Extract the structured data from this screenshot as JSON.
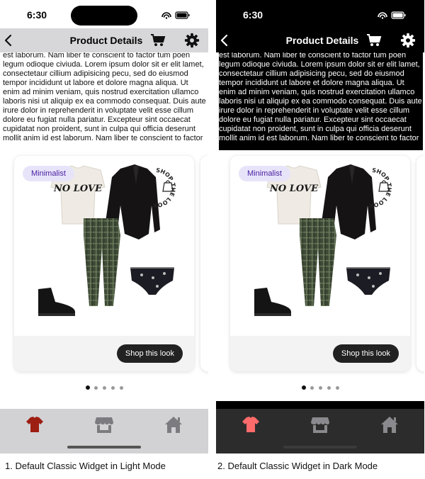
{
  "colors": {
    "accent": "#9d1e12",
    "dark_accent": "#ff6b6b",
    "badge_bg": "#e7e4fa",
    "badge_text": "#4a1da0",
    "dot_active": "#111111",
    "dot_inactive": "#999999"
  },
  "status": {
    "time": "6:30"
  },
  "nav": {
    "title": "Product Details",
    "icons": [
      "chevron-left-icon",
      "cart-icon",
      "gear-icon"
    ]
  },
  "content": {
    "paragraph": "est laborum. Nam liber te conscient to factor tum poen legum odioque civiuda. Lorem ipsum dolor sit er elit lamet, consectetaur cillium adipisicing pecu, sed do eiusmod tempor incididunt ut labore et dolore magna aliqua. Ut enim ad minim veniam, quis nostrud exercitation ullamco laboris nisi ut aliquip ex ea commodo consequat. Duis aute irure dolor in reprehenderit in voluptate velit esse cillum dolore eu fugiat nulla pariatur. Excepteur sint occaecat cupidatat non proident, sunt in culpa qui officia deserunt mollit anim id est laborum. Nam liber te conscient to factor"
  },
  "card": {
    "badge": "Minimalist",
    "shop_label": "Shop this look",
    "stamp_text": "SHOP THE LOOK",
    "tee_print": "NO LOVE"
  },
  "carousel": {
    "total": 5,
    "active": 0
  },
  "tabs": [
    "shirt-icon",
    "store-icon",
    "home-icon"
  ],
  "captions": {
    "light": "1. Default Classic Widget in Light Mode",
    "dark": "2. Default Classic Widget in Dark Mode"
  }
}
